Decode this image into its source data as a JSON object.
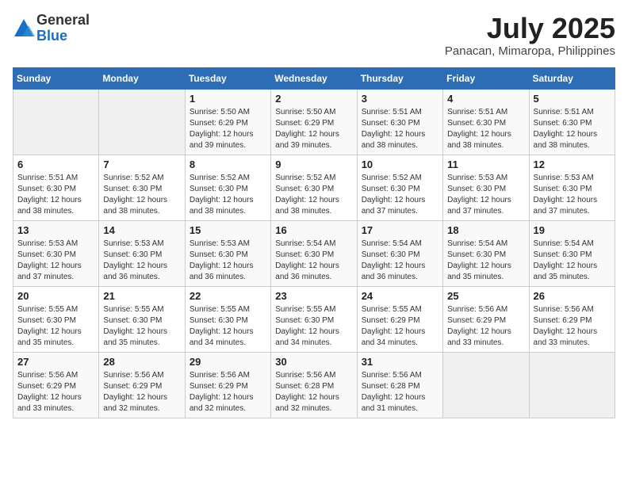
{
  "logo": {
    "general": "General",
    "blue": "Blue"
  },
  "title": "July 2025",
  "location": "Panacan, Mimaropa, Philippines",
  "weekdays": [
    "Sunday",
    "Monday",
    "Tuesday",
    "Wednesday",
    "Thursday",
    "Friday",
    "Saturday"
  ],
  "weeks": [
    [
      {
        "day": "",
        "sunrise": "",
        "sunset": "",
        "daylight": ""
      },
      {
        "day": "",
        "sunrise": "",
        "sunset": "",
        "daylight": ""
      },
      {
        "day": "1",
        "sunrise": "Sunrise: 5:50 AM",
        "sunset": "Sunset: 6:29 PM",
        "daylight": "Daylight: 12 hours and 39 minutes."
      },
      {
        "day": "2",
        "sunrise": "Sunrise: 5:50 AM",
        "sunset": "Sunset: 6:29 PM",
        "daylight": "Daylight: 12 hours and 39 minutes."
      },
      {
        "day": "3",
        "sunrise": "Sunrise: 5:51 AM",
        "sunset": "Sunset: 6:30 PM",
        "daylight": "Daylight: 12 hours and 38 minutes."
      },
      {
        "day": "4",
        "sunrise": "Sunrise: 5:51 AM",
        "sunset": "Sunset: 6:30 PM",
        "daylight": "Daylight: 12 hours and 38 minutes."
      },
      {
        "day": "5",
        "sunrise": "Sunrise: 5:51 AM",
        "sunset": "Sunset: 6:30 PM",
        "daylight": "Daylight: 12 hours and 38 minutes."
      }
    ],
    [
      {
        "day": "6",
        "sunrise": "Sunrise: 5:51 AM",
        "sunset": "Sunset: 6:30 PM",
        "daylight": "Daylight: 12 hours and 38 minutes."
      },
      {
        "day": "7",
        "sunrise": "Sunrise: 5:52 AM",
        "sunset": "Sunset: 6:30 PM",
        "daylight": "Daylight: 12 hours and 38 minutes."
      },
      {
        "day": "8",
        "sunrise": "Sunrise: 5:52 AM",
        "sunset": "Sunset: 6:30 PM",
        "daylight": "Daylight: 12 hours and 38 minutes."
      },
      {
        "day": "9",
        "sunrise": "Sunrise: 5:52 AM",
        "sunset": "Sunset: 6:30 PM",
        "daylight": "Daylight: 12 hours and 38 minutes."
      },
      {
        "day": "10",
        "sunrise": "Sunrise: 5:52 AM",
        "sunset": "Sunset: 6:30 PM",
        "daylight": "Daylight: 12 hours and 37 minutes."
      },
      {
        "day": "11",
        "sunrise": "Sunrise: 5:53 AM",
        "sunset": "Sunset: 6:30 PM",
        "daylight": "Daylight: 12 hours and 37 minutes."
      },
      {
        "day": "12",
        "sunrise": "Sunrise: 5:53 AM",
        "sunset": "Sunset: 6:30 PM",
        "daylight": "Daylight: 12 hours and 37 minutes."
      }
    ],
    [
      {
        "day": "13",
        "sunrise": "Sunrise: 5:53 AM",
        "sunset": "Sunset: 6:30 PM",
        "daylight": "Daylight: 12 hours and 37 minutes."
      },
      {
        "day": "14",
        "sunrise": "Sunrise: 5:53 AM",
        "sunset": "Sunset: 6:30 PM",
        "daylight": "Daylight: 12 hours and 36 minutes."
      },
      {
        "day": "15",
        "sunrise": "Sunrise: 5:53 AM",
        "sunset": "Sunset: 6:30 PM",
        "daylight": "Daylight: 12 hours and 36 minutes."
      },
      {
        "day": "16",
        "sunrise": "Sunrise: 5:54 AM",
        "sunset": "Sunset: 6:30 PM",
        "daylight": "Daylight: 12 hours and 36 minutes."
      },
      {
        "day": "17",
        "sunrise": "Sunrise: 5:54 AM",
        "sunset": "Sunset: 6:30 PM",
        "daylight": "Daylight: 12 hours and 36 minutes."
      },
      {
        "day": "18",
        "sunrise": "Sunrise: 5:54 AM",
        "sunset": "Sunset: 6:30 PM",
        "daylight": "Daylight: 12 hours and 35 minutes."
      },
      {
        "day": "19",
        "sunrise": "Sunrise: 5:54 AM",
        "sunset": "Sunset: 6:30 PM",
        "daylight": "Daylight: 12 hours and 35 minutes."
      }
    ],
    [
      {
        "day": "20",
        "sunrise": "Sunrise: 5:55 AM",
        "sunset": "Sunset: 6:30 PM",
        "daylight": "Daylight: 12 hours and 35 minutes."
      },
      {
        "day": "21",
        "sunrise": "Sunrise: 5:55 AM",
        "sunset": "Sunset: 6:30 PM",
        "daylight": "Daylight: 12 hours and 35 minutes."
      },
      {
        "day": "22",
        "sunrise": "Sunrise: 5:55 AM",
        "sunset": "Sunset: 6:30 PM",
        "daylight": "Daylight: 12 hours and 34 minutes."
      },
      {
        "day": "23",
        "sunrise": "Sunrise: 5:55 AM",
        "sunset": "Sunset: 6:30 PM",
        "daylight": "Daylight: 12 hours and 34 minutes."
      },
      {
        "day": "24",
        "sunrise": "Sunrise: 5:55 AM",
        "sunset": "Sunset: 6:29 PM",
        "daylight": "Daylight: 12 hours and 34 minutes."
      },
      {
        "day": "25",
        "sunrise": "Sunrise: 5:56 AM",
        "sunset": "Sunset: 6:29 PM",
        "daylight": "Daylight: 12 hours and 33 minutes."
      },
      {
        "day": "26",
        "sunrise": "Sunrise: 5:56 AM",
        "sunset": "Sunset: 6:29 PM",
        "daylight": "Daylight: 12 hours and 33 minutes."
      }
    ],
    [
      {
        "day": "27",
        "sunrise": "Sunrise: 5:56 AM",
        "sunset": "Sunset: 6:29 PM",
        "daylight": "Daylight: 12 hours and 33 minutes."
      },
      {
        "day": "28",
        "sunrise": "Sunrise: 5:56 AM",
        "sunset": "Sunset: 6:29 PM",
        "daylight": "Daylight: 12 hours and 32 minutes."
      },
      {
        "day": "29",
        "sunrise": "Sunrise: 5:56 AM",
        "sunset": "Sunset: 6:29 PM",
        "daylight": "Daylight: 12 hours and 32 minutes."
      },
      {
        "day": "30",
        "sunrise": "Sunrise: 5:56 AM",
        "sunset": "Sunset: 6:28 PM",
        "daylight": "Daylight: 12 hours and 32 minutes."
      },
      {
        "day": "31",
        "sunrise": "Sunrise: 5:56 AM",
        "sunset": "Sunset: 6:28 PM",
        "daylight": "Daylight: 12 hours and 31 minutes."
      },
      {
        "day": "",
        "sunrise": "",
        "sunset": "",
        "daylight": ""
      },
      {
        "day": "",
        "sunrise": "",
        "sunset": "",
        "daylight": ""
      }
    ]
  ]
}
